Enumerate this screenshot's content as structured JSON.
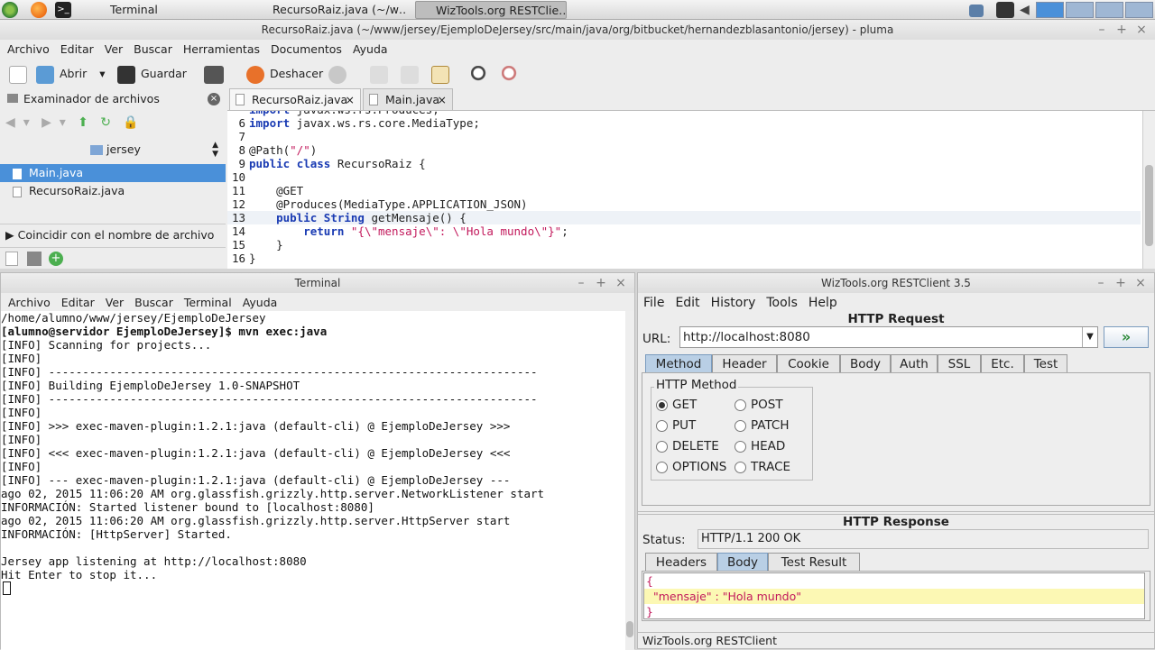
{
  "taskbar": {
    "tasks": [
      {
        "label": "Terminal",
        "active": false
      },
      {
        "label": "RecursoRaiz.java (~/w…",
        "active": false
      },
      {
        "label": "WizTools.org RESTClie…",
        "active": true
      }
    ]
  },
  "pluma": {
    "title": "RecursoRaiz.java (~/www/jersey/EjemploDeJersey/src/main/java/org/bitbucket/hernandezblasantonio/jersey) - pluma",
    "menu": [
      "Archivo",
      "Editar",
      "Ver",
      "Buscar",
      "Herramientas",
      "Documentos",
      "Ayuda"
    ],
    "toolbar": {
      "open": "Abrir",
      "save": "Guardar",
      "undo": "Deshacer"
    },
    "side": {
      "header": "Examinador de archivos",
      "folder": "jersey",
      "files": [
        "Main.java",
        "RecursoRaiz.java"
      ],
      "filter": "Coincidir con el nombre de archivo"
    },
    "tabs": [
      "RecursoRaiz.java",
      "Main.java"
    ],
    "lines": [
      {
        "n": "",
        "t": "import javax.ws.rs.Produces;"
      },
      {
        "n": "6",
        "t": "import javax.ws.rs.core.MediaType;"
      },
      {
        "n": "7",
        "t": ""
      },
      {
        "n": "8",
        "t": "@Path(\"/\")"
      },
      {
        "n": "9",
        "t": "public class RecursoRaiz {"
      },
      {
        "n": "10",
        "t": ""
      },
      {
        "n": "11",
        "t": "    @GET"
      },
      {
        "n": "12",
        "t": "    @Produces(MediaType.APPLICATION_JSON)"
      },
      {
        "n": "13",
        "t": "    public String getMensaje() {"
      },
      {
        "n": "14",
        "t": "        return \"{\\\"mensaje\\\": \\\"Hola mundo\\\"}\";"
      },
      {
        "n": "15",
        "t": "    }"
      },
      {
        "n": "16",
        "t": "}"
      }
    ]
  },
  "terminal": {
    "title": "Terminal",
    "menu": [
      "Archivo",
      "Editar",
      "Ver",
      "Buscar",
      "Terminal",
      "Ayuda"
    ],
    "lines": [
      "/home/alumno/www/jersey/EjemploDeJersey",
      "[alumno@servidor EjemploDeJersey]$ mvn exec:java",
      "[INFO] Scanning for projects...",
      "[INFO]",
      "[INFO] ------------------------------------------------------------------------",
      "[INFO] Building EjemploDeJersey 1.0-SNAPSHOT",
      "[INFO] ------------------------------------------------------------------------",
      "[INFO]",
      "[INFO] >>> exec-maven-plugin:1.2.1:java (default-cli) @ EjemploDeJersey >>>",
      "[INFO]",
      "[INFO] <<< exec-maven-plugin:1.2.1:java (default-cli) @ EjemploDeJersey <<<",
      "[INFO]",
      "[INFO] --- exec-maven-plugin:1.2.1:java (default-cli) @ EjemploDeJersey ---",
      "ago 02, 2015 11:06:20 AM org.glassfish.grizzly.http.server.NetworkListener start",
      "INFORMACIÓN: Started listener bound to [localhost:8080]",
      "ago 02, 2015 11:06:20 AM org.glassfish.grizzly.http.server.HttpServer start",
      "INFORMACIÓN: [HttpServer] Started.",
      "",
      "Jersey app listening at http://localhost:8080",
      "Hit Enter to stop it..."
    ]
  },
  "rest": {
    "title": "WizTools.org RESTClient 3.5",
    "menu": [
      "File",
      "Edit",
      "History",
      "Tools",
      "Help"
    ],
    "request_header": "HTTP Request",
    "url_label": "URL:",
    "url": "http://localhost:8080",
    "req_tabs": [
      "Method",
      "Header",
      "Cookie",
      "Body",
      "Auth",
      "SSL",
      "Etc.",
      "Test"
    ],
    "method_group": "HTTP Method",
    "methods": [
      "GET",
      "POST",
      "PUT",
      "PATCH",
      "DELETE",
      "HEAD",
      "OPTIONS",
      "TRACE"
    ],
    "selected_method": "GET",
    "response_header": "HTTP Response",
    "status_label": "Status:",
    "status": "HTTP/1.1 200 OK",
    "resp_tabs": [
      "Headers",
      "Body",
      "Test Result"
    ],
    "body": [
      "{",
      "  \"mensaje\" : \"Hola mundo\"",
      "}"
    ],
    "footer": "WizTools.org RESTClient"
  },
  "colors": {
    "accent": "#4a90d9",
    "selection": "#4a90d9",
    "string": "#c2185b",
    "highlight": "#fcf8b4"
  }
}
